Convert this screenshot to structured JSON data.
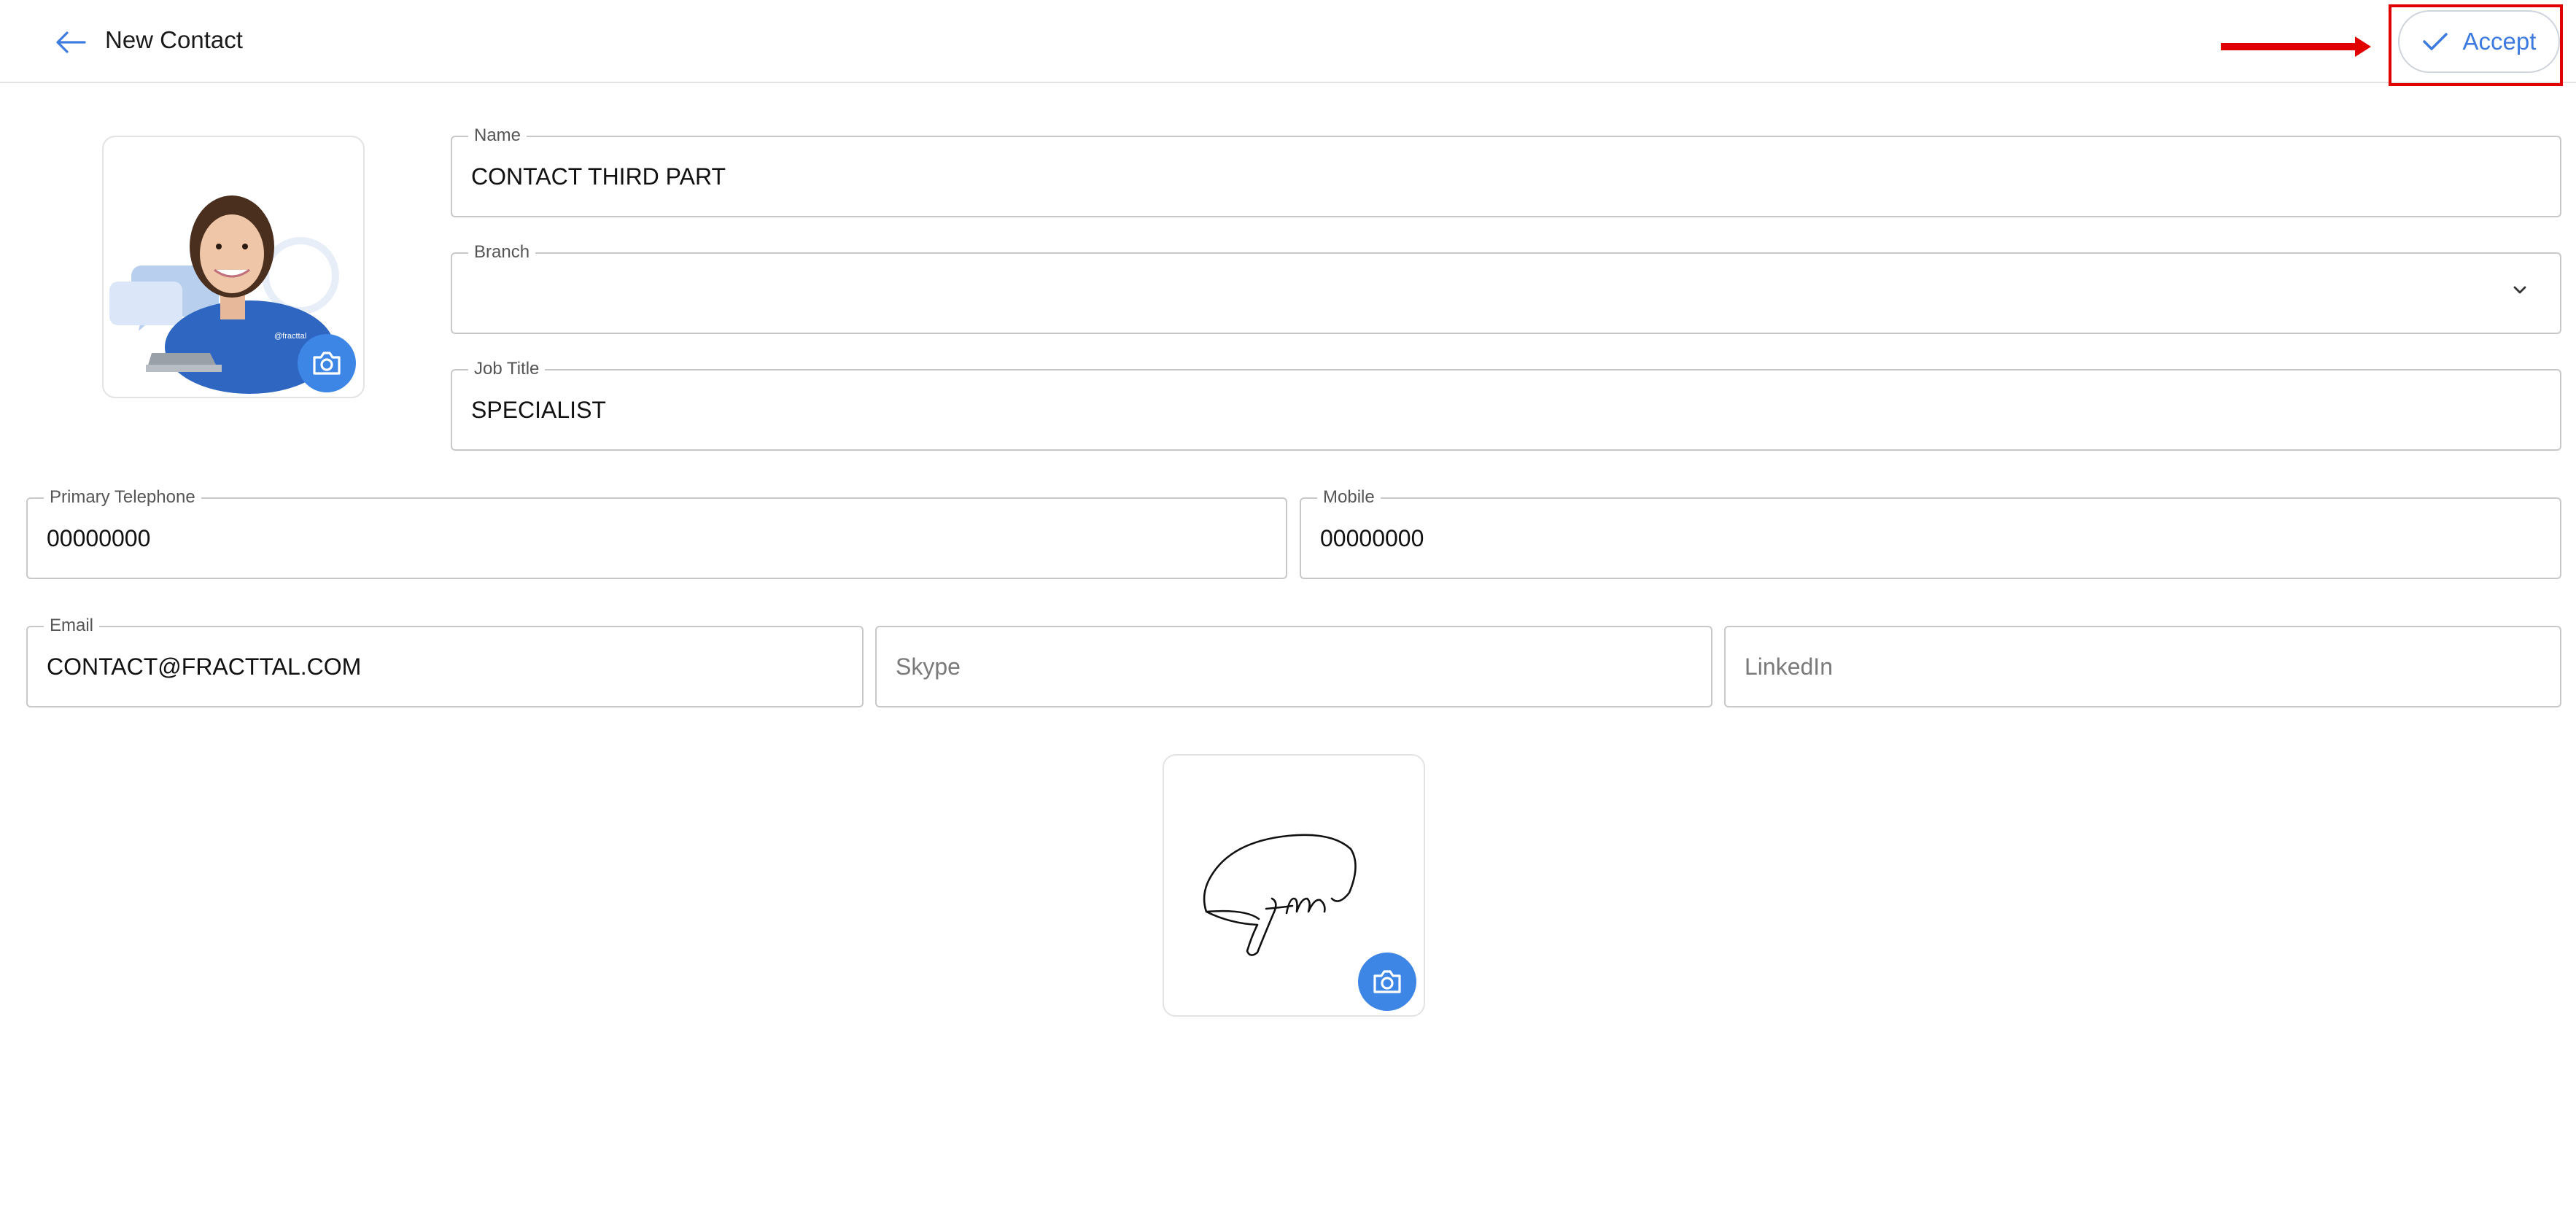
{
  "header": {
    "title": "New Contact",
    "back_icon": "arrow-left-icon",
    "accept_label": "Accept",
    "accept_icon": "check-icon"
  },
  "form": {
    "name": {
      "label": "Name",
      "value": "CONTACT THIRD PART"
    },
    "branch": {
      "label": "Branch",
      "value": ""
    },
    "job_title": {
      "label": "Job Title",
      "value": "SPECIALIST"
    },
    "primary_telephone": {
      "label": "Primary Telephone",
      "value": "00000000"
    },
    "mobile": {
      "label": "Mobile",
      "value": "00000000"
    },
    "email": {
      "label": "Email",
      "value": "CONTACT@FRACTTAL.COM"
    },
    "skype": {
      "placeholder": "Skype",
      "value": ""
    },
    "linkedin": {
      "placeholder": "LinkedIn",
      "value": ""
    }
  },
  "photo": {
    "shirt_logo": "@fracttal"
  },
  "colors": {
    "accent": "#3d7be0",
    "camera_button": "#3d86e6",
    "annotation": "#e00000"
  }
}
